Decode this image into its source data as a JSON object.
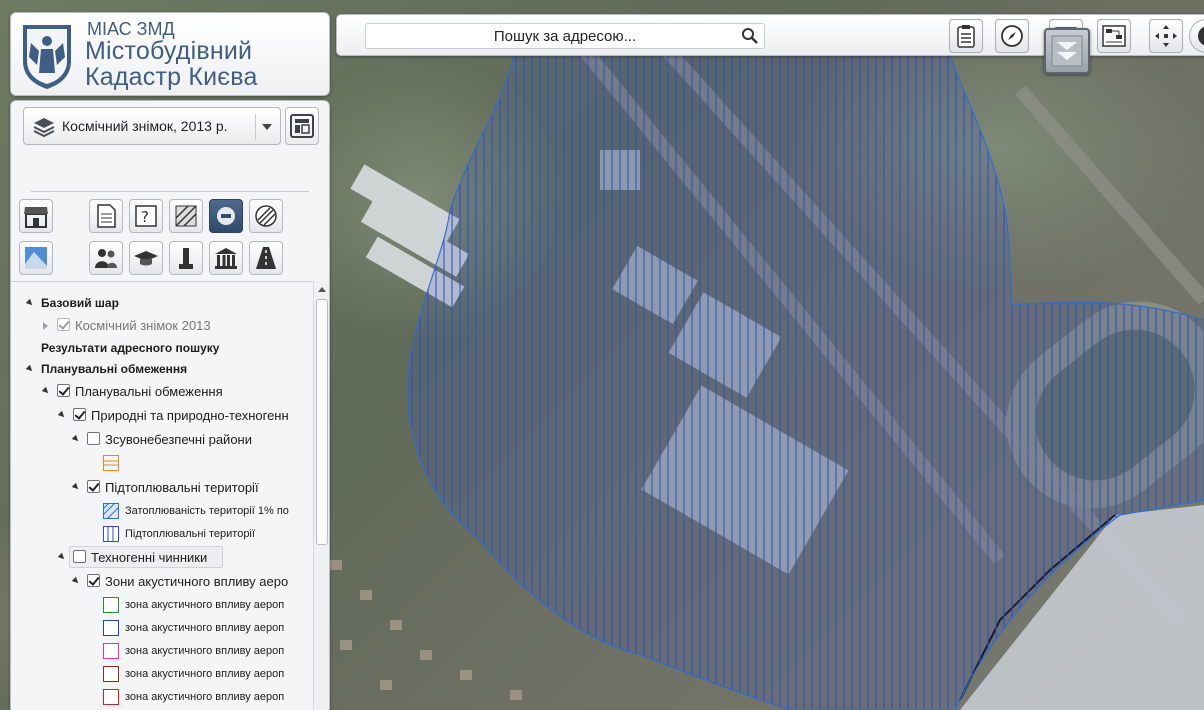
{
  "logo": {
    "small_title": "МІАС ЗМД",
    "line1": "Містобудівний",
    "line2": "Кадастр Києва"
  },
  "basemap": {
    "selected": "Космічний знімок, 2013 р."
  },
  "search": {
    "placeholder": "Пошук за адресою..."
  },
  "toolbar_icons": [
    "print-clipboard-icon",
    "compass-icon",
    "calendar-icon",
    "flowchart-icon",
    "pan-arrows-icon",
    "power-icon"
  ],
  "layer_tools": {
    "row1": [
      "shop-icon",
      "document-icon",
      "puzzle-icon",
      "hatched-square-icon",
      "minus-circle-icon",
      "hatched-circle-icon"
    ],
    "row2": [
      "map-icon",
      "people-icon",
      "graduation-cap-icon",
      "monument-icon",
      "museum-icon",
      "road-icon"
    ],
    "active": "minus-circle-icon"
  },
  "tree": {
    "base_layer": "Базовий шар",
    "base_item": "Космічний знімок 2013",
    "search_results": "Результати адресного пошуку",
    "planning": "Планувальні обмеження",
    "planning_child": "Планувальні обмеження",
    "natural": "Природні та природно-техногенн",
    "landslide": "Зсувонебезпечні райони",
    "flooding": "Підтоплювальні території",
    "flood_1pct": "Затоплюваність території 1% по",
    "flood_legend": "Підтоплювальні території",
    "technogenic": "Техногенні чинники",
    "acoustic": "Зони акустичного впливу аеро",
    "acoustic_item": "зона акустичного впливу аероп"
  },
  "colors": {
    "accent": "#3f5e86",
    "hatch": "#2a4fc8",
    "swatch_orange": "#e58a1f",
    "swatch_blue_hatch": "#2a6fdb",
    "acoustic_green": "#2e8b2e",
    "acoustic_blue": "#1f3fd6",
    "acoustic_magenta": "#d62fd6",
    "acoustic_brown": "#8b2a1f",
    "acoustic_red": "#d21f1f"
  }
}
